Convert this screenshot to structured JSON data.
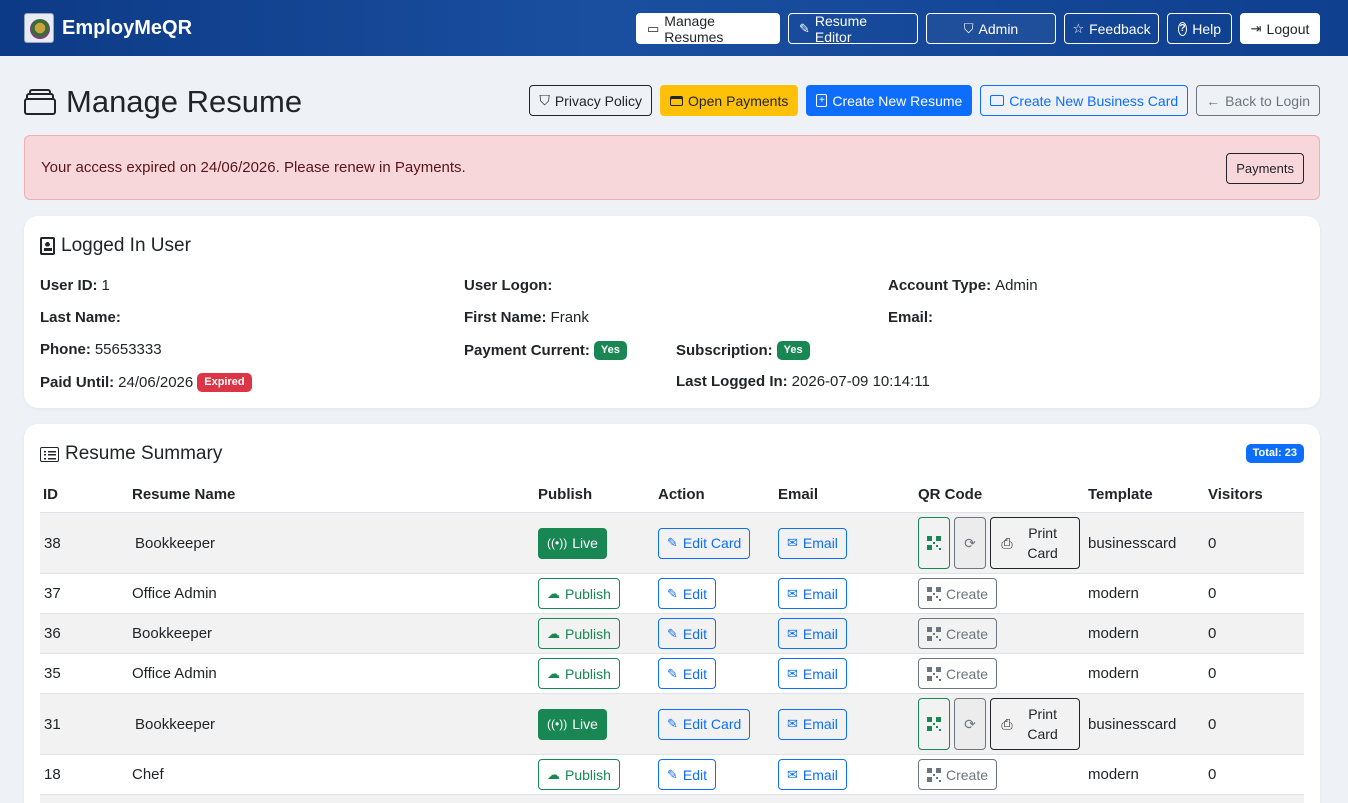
{
  "nav": {
    "brand": "EmployMeQR",
    "items": [
      {
        "label": "Manage Resumes",
        "icon": "stack-icon",
        "glyph": "▭"
      },
      {
        "label": "Resume Editor",
        "icon": "edit-icon",
        "glyph": "✎"
      },
      {
        "label": "Admin",
        "icon": "shield-icon",
        "glyph": "⛉"
      },
      {
        "label": "Feedback",
        "icon": "star-icon",
        "glyph": "☆"
      },
      {
        "label": "Help",
        "icon": "question-icon",
        "glyph": "?"
      },
      {
        "label": "Logout",
        "icon": "logout-icon",
        "glyph": "⇥"
      }
    ]
  },
  "page": {
    "title": "Manage Resume",
    "buttons": {
      "privacy": "Privacy Policy",
      "payments": "Open Payments",
      "new_resume": "Create New Resume",
      "new_card": "Create New Business Card",
      "back": "Back to Login"
    }
  },
  "alert": {
    "message": "Your access expired on 24/06/2026. Please renew in Payments.",
    "button": "Payments"
  },
  "user": {
    "title": "Logged In User",
    "fields": {
      "user_id_label": "User ID:",
      "user_id": "1",
      "logon_label": "User Logon:",
      "logon": "",
      "account_type_label": "Account Type:",
      "account_type": "Admin",
      "last_name_label": "Last Name:",
      "last_name": "",
      "first_name_label": "First Name:",
      "first_name": "Frank",
      "email_label": "Email:",
      "email": "",
      "phone_label": "Phone:",
      "phone": "55653333",
      "payment_current_label": "Payment Current:",
      "payment_current": "Yes",
      "subscription_label": "Subscription:",
      "subscription": "Yes",
      "paid_until_label": "Paid Until:",
      "paid_until": "24/06/2026",
      "paid_status": "Expired",
      "last_logged_label": "Last Logged In:",
      "last_logged": "2026-07-09 10:14:11"
    }
  },
  "resumes": {
    "title": "Resume Summary",
    "total": "Total: 23",
    "columns": [
      "ID",
      "Resume Name",
      "Publish",
      "Action",
      "Email",
      "QR Code",
      "Template",
      "Visitors"
    ],
    "rows": [
      {
        "id": "38",
        "name": "Bookkeeper",
        "publish": "Live",
        "action": "Edit Card",
        "email": "Email",
        "qr": "card",
        "print": "Print Card",
        "template": "businesscard",
        "visitors": "0"
      },
      {
        "id": "37",
        "name": "Office Admin",
        "publish": "Publish",
        "action": "Edit",
        "email": "Email",
        "qr": "create",
        "create": "Create",
        "template": "modern",
        "visitors": "0"
      },
      {
        "id": "36",
        "name": "Bookkeeper",
        "publish": "Publish",
        "action": "Edit",
        "email": "Email",
        "qr": "create",
        "create": "Create",
        "template": "modern",
        "visitors": "0"
      },
      {
        "id": "35",
        "name": "Office Admin",
        "publish": "Publish",
        "action": "Edit",
        "email": "Email",
        "qr": "create",
        "create": "Create",
        "template": "modern",
        "visitors": "0"
      },
      {
        "id": "31",
        "name": "Bookkeeper",
        "publish": "Live",
        "action": "Edit Card",
        "email": "Email",
        "qr": "card",
        "print": "Print Card",
        "template": "businesscard",
        "visitors": "0"
      },
      {
        "id": "18",
        "name": "Chef",
        "publish": "Publish",
        "action": "Edit",
        "email": "Email",
        "qr": "create",
        "create": "Create",
        "template": "modern",
        "visitors": "0"
      }
    ]
  },
  "colors": {
    "nav": "#1a4fa0",
    "success": "#198754",
    "primary": "#0d6efd",
    "warning": "#ffc107",
    "danger": "#dc3545"
  }
}
